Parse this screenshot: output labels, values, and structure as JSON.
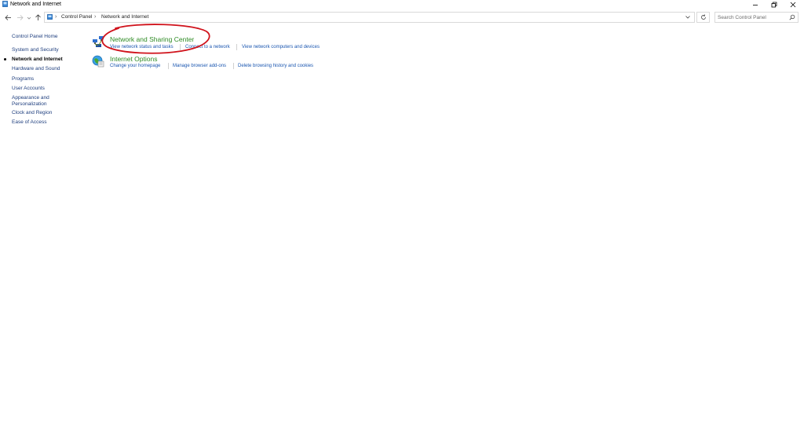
{
  "window": {
    "title": "Network and Internet",
    "controls": {
      "minimize_icon": "minimize-icon",
      "restore_icon": "restore-icon",
      "close_icon": "close-icon"
    }
  },
  "navigation": {
    "breadcrumb": [
      "Control Panel",
      "Network and Internet"
    ],
    "search_placeholder": "Search Control Panel"
  },
  "sidebar": {
    "home": "Control Panel Home",
    "items": [
      {
        "label": "System and Security",
        "active": false
      },
      {
        "label": "Network and Internet",
        "active": true
      },
      {
        "label": "Hardware and Sound",
        "active": false
      },
      {
        "label": "Programs",
        "active": false
      },
      {
        "label": "User Accounts",
        "active": false
      },
      {
        "label": "Appearance and",
        "label2": "Personalization",
        "active": false
      },
      {
        "label": "Clock and Region",
        "active": false
      },
      {
        "label": "Ease of Access",
        "active": false
      }
    ]
  },
  "main": {
    "categories": [
      {
        "title": "Network and Sharing Center",
        "icon": "network-sharing-icon",
        "tasks": [
          "View network status and tasks",
          "Connect to a network",
          "View network computers and devices"
        ]
      },
      {
        "title": "Internet Options",
        "icon": "internet-options-icon",
        "tasks": [
          "Change your homepage",
          "Manage browser add-ons",
          "Delete browsing history and cookies"
        ]
      }
    ]
  },
  "annotation": {
    "shape": "ellipse",
    "color": "#d0121b"
  },
  "colors": {
    "link": "#1a56b0",
    "category_title": "#2e8b24",
    "sidebar_link": "#1e3e7e"
  }
}
